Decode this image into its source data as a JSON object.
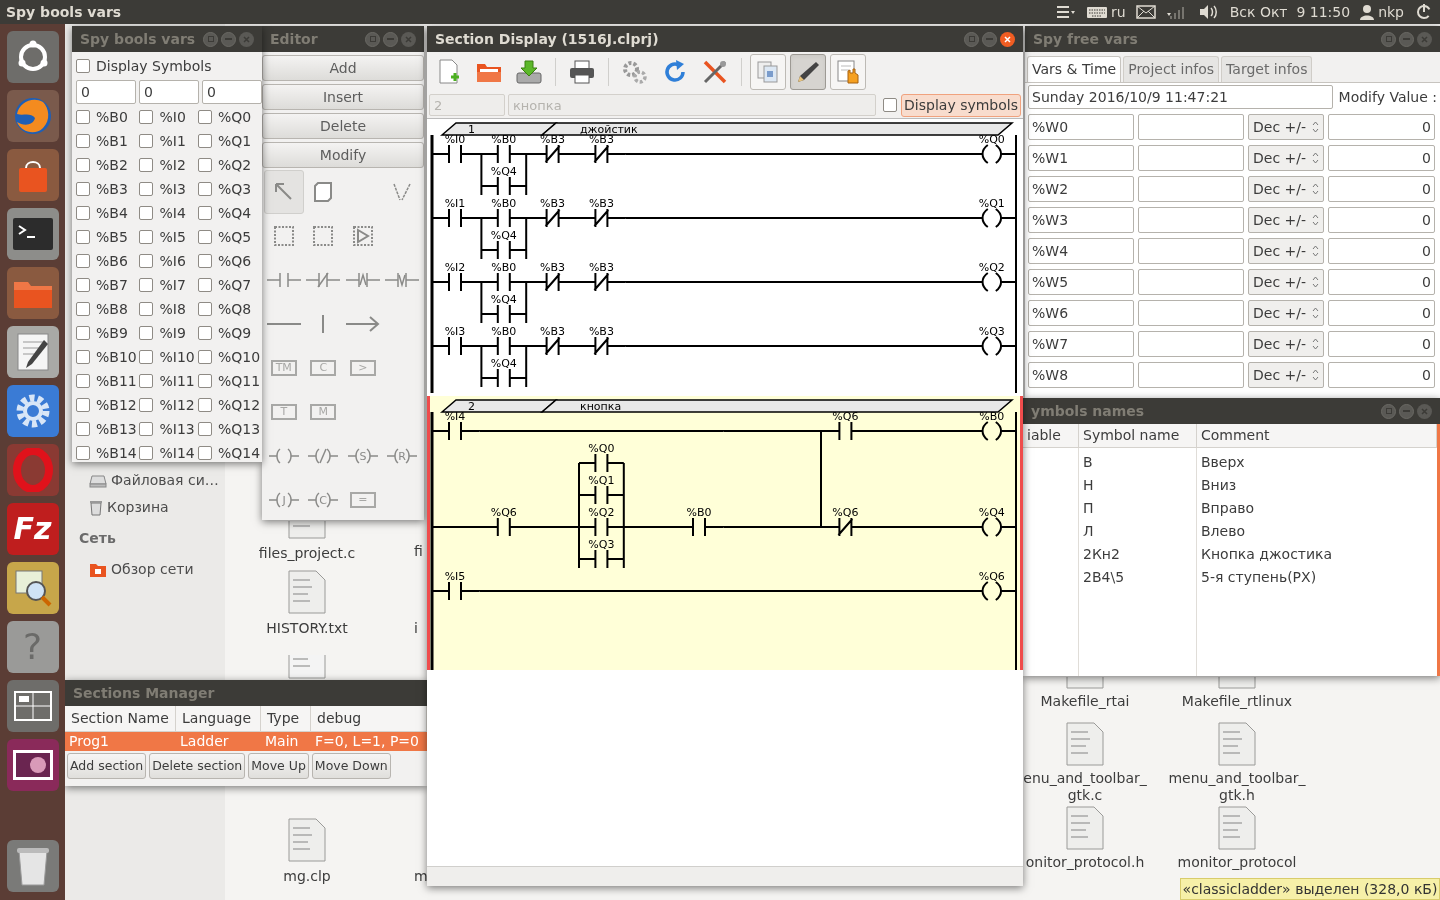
{
  "top_panel": {
    "app_title": "Spy bools vars",
    "keyboard": "ru",
    "clock": "Вск Окт  9 11:50",
    "user": "nkp"
  },
  "launcher": [
    {
      "kind": "dash"
    },
    {
      "kind": "browser"
    },
    {
      "kind": "store"
    },
    {
      "kind": "terminal"
    },
    {
      "kind": "files"
    },
    {
      "kind": "editor"
    },
    {
      "kind": "settings"
    },
    {
      "kind": "opera"
    },
    {
      "kind": "filezilla",
      "text": "Fz"
    },
    {
      "kind": "viewer"
    },
    {
      "kind": "help",
      "text": "?"
    },
    {
      "kind": "workspaces"
    },
    {
      "kind": "desktop"
    },
    {
      "kind": "trash"
    }
  ],
  "file_manager": {
    "places": [
      {
        "kind": "drive",
        "label": "Файловая си…"
      },
      {
        "kind": "trash",
        "label": "Корзина"
      },
      {
        "kind": "header",
        "label": "Сеть"
      },
      {
        "kind": "network",
        "label": "Обзор сети"
      }
    ],
    "files_left": [
      {
        "lines": [
          "files_project.c"
        ]
      },
      {
        "lines": [
          "HISTORY.txt"
        ]
      },
      {
        "kind": "icon_only"
      },
      {
        "lines": [
          "mg.clp"
        ]
      }
    ],
    "files_cut": [
      "fi",
      "i",
      "m"
    ],
    "files_right": [
      {
        "lines": [
          "Makefile_rtai"
        ]
      },
      {
        "lines": [
          "Makefile_rtlinux"
        ]
      },
      {
        "lines": [
          "enu_and_toolbar_",
          "gtk.c"
        ]
      },
      {
        "lines": [
          "menu_and_toolbar_",
          "gtk.h"
        ]
      },
      {
        "lines": [
          "onitor_protocol.h"
        ]
      },
      {
        "lines": [
          "monitor_protocol"
        ]
      }
    ],
    "status": "«classicladder» выделен (328,0 кБ)"
  },
  "spy_bools": {
    "title": "Spy bools vars",
    "display_symbols": {
      "label": "Display Symbols",
      "checked": false
    },
    "offsets": [
      "0",
      "0",
      "0"
    ],
    "columns": [
      [
        {
          "label": "%B0",
          "checked": false
        },
        {
          "label": "%B1",
          "checked": false
        },
        {
          "label": "%B2",
          "checked": false
        },
        {
          "label": "%B3",
          "checked": false
        },
        {
          "label": "%B4",
          "checked": false
        },
        {
          "label": "%B5",
          "checked": false
        },
        {
          "label": "%B6",
          "checked": false
        },
        {
          "label": "%B7",
          "checked": false
        },
        {
          "label": "%B8",
          "checked": false
        },
        {
          "label": "%B9",
          "checked": false
        },
        {
          "label": "%B10",
          "checked": false
        },
        {
          "label": "%B11",
          "checked": false
        },
        {
          "label": "%B12",
          "checked": false
        },
        {
          "label": "%B13",
          "checked": false
        },
        {
          "label": "%B14",
          "checked": false
        }
      ],
      [
        {
          "label": "%I0",
          "checked": false
        },
        {
          "label": "%I1",
          "checked": false
        },
        {
          "label": "%I2",
          "checked": false
        },
        {
          "label": "%I3",
          "checked": false
        },
        {
          "label": "%I4",
          "checked": false
        },
        {
          "label": "%I5",
          "checked": false
        },
        {
          "label": "%I6",
          "checked": false
        },
        {
          "label": "%I7",
          "checked": false
        },
        {
          "label": "%I8",
          "checked": false
        },
        {
          "label": "%I9",
          "checked": false
        },
        {
          "label": "%I10",
          "checked": false
        },
        {
          "label": "%I11",
          "checked": false
        },
        {
          "label": "%I12",
          "checked": false
        },
        {
          "label": "%I13",
          "checked": false
        },
        {
          "label": "%I14",
          "checked": false
        }
      ],
      [
        {
          "label": "%Q0",
          "checked": false
        },
        {
          "label": "%Q1",
          "checked": false
        },
        {
          "label": "%Q2",
          "checked": false
        },
        {
          "label": "%Q3",
          "checked": false
        },
        {
          "label": "%Q4",
          "checked": false
        },
        {
          "label": "%Q5",
          "checked": false
        },
        {
          "label": "%Q6",
          "checked": false
        },
        {
          "label": "%Q7",
          "checked": false
        },
        {
          "label": "%Q8",
          "checked": false
        },
        {
          "label": "%Q9",
          "checked": false
        },
        {
          "label": "%Q10",
          "checked": false
        },
        {
          "label": "%Q11",
          "checked": false
        },
        {
          "label": "%Q12",
          "checked": false
        },
        {
          "label": "%Q13",
          "checked": false
        },
        {
          "label": "%Q14",
          "checked": false
        }
      ]
    ]
  },
  "editor": {
    "title": "Editor",
    "buttons": [
      "Add",
      "Insert",
      "Delete",
      "Modify"
    ],
    "palette": [
      {
        "kind": "pointer",
        "selected": true
      },
      {
        "kind": "eraser",
        "selected": false
      },
      {
        "kind": "blank",
        "selected": false
      },
      {
        "kind": "connector",
        "selected": false
      },
      {
        "kind": "select",
        "selected": false
      },
      {
        "kind": "select",
        "selected": false
      },
      {
        "kind": "select_move",
        "selected": false
      },
      {
        "kind": "blank",
        "selected": false
      },
      {
        "kind": "contact_no",
        "selected": false
      },
      {
        "kind": "contact_nc",
        "selected": false
      },
      {
        "kind": "contact_rise",
        "selected": false
      },
      {
        "kind": "contact_fall",
        "selected": false
      },
      {
        "kind": "hwire",
        "selected": false
      },
      {
        "kind": "vwire",
        "selected": false
      },
      {
        "kind": "longwire",
        "selected": false
      },
      {
        "kind": "blank",
        "selected": false
      },
      {
        "kind": "box",
        "text": "TM",
        "selected": false
      },
      {
        "kind": "box",
        "text": "C",
        "selected": false
      },
      {
        "kind": "box",
        "text": ">",
        "selected": false
      },
      {
        "kind": "blank",
        "selected": false
      },
      {
        "kind": "box",
        "text": "T",
        "selected": false
      },
      {
        "kind": "box",
        "text": "M",
        "selected": false
      },
      {
        "kind": "blank",
        "selected": false
      },
      {
        "kind": "blank",
        "selected": false
      },
      {
        "kind": "coil",
        "selected": false
      },
      {
        "kind": "coil_not",
        "selected": false
      },
      {
        "kind": "coil",
        "text": "S",
        "selected": false
      },
      {
        "kind": "coil",
        "text": "R",
        "selected": false
      },
      {
        "kind": "coil",
        "text": "J",
        "selected": false
      },
      {
        "kind": "coil",
        "text": "C",
        "selected": false
      },
      {
        "kind": "box",
        "text": "=",
        "selected": false
      },
      {
        "kind": "blank",
        "selected": false
      }
    ]
  },
  "section_display": {
    "title": "Section Display (1516J.clprj)",
    "toolbar": [
      {
        "kind": "new"
      },
      {
        "kind": "open"
      },
      {
        "kind": "save"
      },
      {
        "kind": "sep"
      },
      {
        "kind": "print"
      },
      {
        "kind": "sep"
      },
      {
        "kind": "gears"
      },
      {
        "kind": "refresh"
      },
      {
        "kind": "tools"
      },
      {
        "kind": "sep"
      },
      {
        "kind": "copy",
        "pressed": false
      },
      {
        "kind": "edit",
        "pressed": true
      },
      {
        "kind": "hand",
        "pressed": false
      }
    ],
    "rung_number": "2",
    "rung_comment": "кнопка",
    "display_symbols": {
      "label": "Display symbols",
      "checked": false
    },
    "sections": [
      {
        "number": "1",
        "comment": "джойстик",
        "highlighted": false,
        "lines": [
          {
            "kind": "rung",
            "cells": [
              {
                "kind": "no",
                "label": "%I0"
              },
              {
                "kind": "parallel",
                "main": {
                  "kind": "no",
                  "label": "%B0"
                },
                "below": [
                  {
                    "kind": "no",
                    "label": "%Q4"
                  }
                ]
              },
              {
                "kind": "nc",
                "label": "%B3"
              },
              {
                "kind": "nc",
                "label": "%B3"
              }
            ],
            "coil": "%Q0"
          },
          {
            "kind": "rung",
            "cells": [
              {
                "kind": "no",
                "label": "%I1"
              },
              {
                "kind": "parallel",
                "main": {
                  "kind": "no",
                  "label": "%B0"
                },
                "below": [
                  {
                    "kind": "no",
                    "label": "%Q4"
                  }
                ]
              },
              {
                "kind": "nc",
                "label": "%B3"
              },
              {
                "kind": "nc",
                "label": "%B3"
              }
            ],
            "coil": "%Q1"
          },
          {
            "kind": "rung",
            "cells": [
              {
                "kind": "no",
                "label": "%I2"
              },
              {
                "kind": "parallel",
                "main": {
                  "kind": "no",
                  "label": "%B0"
                },
                "below": [
                  {
                    "kind": "no",
                    "label": "%Q4"
                  }
                ]
              },
              {
                "kind": "nc",
                "label": "%B3"
              },
              {
                "kind": "nc",
                "label": "%B3"
              }
            ],
            "coil": "%Q2"
          },
          {
            "kind": "rung",
            "cells": [
              {
                "kind": "no",
                "label": "%I3"
              },
              {
                "kind": "parallel",
                "main": {
                  "kind": "no",
                  "label": "%B0"
                },
                "below": [
                  {
                    "kind": "no",
                    "label": "%Q4"
                  }
                ]
              },
              {
                "kind": "nc",
                "label": "%B3"
              },
              {
                "kind": "nc",
                "label": "%B3"
              }
            ],
            "coil": "%Q3"
          }
        ]
      },
      {
        "number": "2",
        "comment": "кнопка",
        "highlighted": true,
        "lines": [
          {
            "kind": "rung",
            "cells": [
              {
                "kind": "no",
                "label": "%I4"
              },
              {
                "kind": "wire"
              },
              {
                "kind": "wire"
              },
              {
                "kind": "wire"
              },
              {
                "kind": "wire"
              },
              {
                "kind": "wire"
              },
              {
                "kind": "wire"
              },
              {
                "kind": "wire"
              },
              {
                "kind": "no",
                "label": "%Q6"
              }
            ],
            "coil": "%B0"
          },
          {
            "kind": "joined",
            "cells": [
              {
                "kind": "wire"
              },
              {
                "kind": "no",
                "label": "%Q6"
              },
              {
                "kind": "wire"
              },
              {
                "kind": "parallel",
                "above": [
                  {
                    "kind": "no",
                    "label": "%Q0"
                  },
                  {
                    "kind": "no",
                    "label": "%Q1"
                  }
                ],
                "main": {
                  "kind": "no",
                  "label": "%Q2"
                },
                "below": [
                  {
                    "kind": "no",
                    "label": "%Q3"
                  }
                ]
              },
              {
                "kind": "wire"
              },
              {
                "kind": "no",
                "label": "%B0"
              },
              {
                "kind": "wire"
              },
              {
                "kind": "wire"
              },
              {
                "kind": "nc",
                "label": "%Q6"
              }
            ],
            "coil": "%Q4"
          },
          {
            "kind": "rung",
            "cells": [
              {
                "kind": "no",
                "label": "%I5"
              }
            ],
            "coil": "%Q6"
          }
        ]
      }
    ]
  },
  "spy_free": {
    "title": "Spy free vars",
    "tabs": [
      {
        "label": "Vars & Time",
        "selected": true
      },
      {
        "label": "Project infos",
        "selected": false
      },
      {
        "label": "Target infos",
        "selected": false
      }
    ],
    "datetime": "Sunday 2016/10/9 11:47:21",
    "modify_label": "Modify Value :",
    "rows": [
      {
        "variable": "%W0",
        "format": "Dec +/-",
        "value": "0"
      },
      {
        "variable": "%W1",
        "format": "Dec +/-",
        "value": "0"
      },
      {
        "variable": "%W2",
        "format": "Dec +/-",
        "value": "0"
      },
      {
        "variable": "%W3",
        "format": "Dec +/-",
        "value": "0"
      },
      {
        "variable": "%W4",
        "format": "Dec +/-",
        "value": "0"
      },
      {
        "variable": "%W5",
        "format": "Dec +/-",
        "value": "0"
      },
      {
        "variable": "%W6",
        "format": "Dec +/-",
        "value": "0"
      },
      {
        "variable": "%W7",
        "format": "Dec +/-",
        "value": "0"
      },
      {
        "variable": "%W8",
        "format": "Dec +/-",
        "value": "0"
      }
    ]
  },
  "symbols": {
    "title": "ymbols names",
    "columns": [
      "iable",
      "Symbol name",
      "Comment"
    ],
    "rows": [
      {
        "symbol": "В",
        "comment": "Вверх"
      },
      {
        "symbol": "Н",
        "comment": "Вниз"
      },
      {
        "symbol": "П",
        "comment": "Вправо"
      },
      {
        "symbol": "Л",
        "comment": "Влево"
      },
      {
        "symbol": "2Кн2",
        "comment": "Кнопка джостика"
      },
      {
        "symbol": "2В4\\5",
        "comment": "5-я ступень(РХ)"
      }
    ]
  },
  "sections_manager": {
    "title": "Sections Manager",
    "columns": [
      "Section Name",
      "Language",
      "Type",
      "debug"
    ],
    "rows": [
      {
        "cells": [
          "Prog1",
          "Ladder",
          "Main",
          "F=0, L=1, P=0"
        ],
        "selected": true
      }
    ],
    "buttons": [
      "Add section",
      "Delete section",
      "Move Up",
      "Move Down"
    ]
  }
}
